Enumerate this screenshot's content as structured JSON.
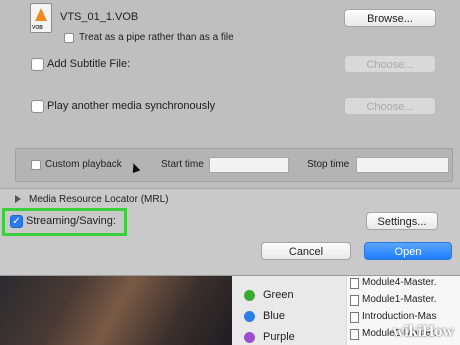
{
  "file": {
    "name": "VTS_01_1.VOB",
    "icon_caption": "VOB",
    "browse_label": "Browse...",
    "pipe_label": "Treat as a pipe rather than as a file"
  },
  "subtitle": {
    "label": "Add Subtitle File:",
    "choose_label": "Choose..."
  },
  "sync_media": {
    "label": "Play another media synchronously",
    "choose_label": "Choose..."
  },
  "custom_playback": {
    "label": "Custom playback",
    "start_label": "Start time",
    "start_value": "",
    "stop_label": "Stop time",
    "stop_value": ""
  },
  "mrl": {
    "label": "Media Resource Locator (MRL)"
  },
  "streaming": {
    "label": "Streaming/Saving:",
    "checked": true,
    "settings_label": "Settings..."
  },
  "actions": {
    "cancel_label": "Cancel",
    "open_label": "Open"
  },
  "finder": {
    "tags": [
      {
        "name": "Green",
        "color": "#3aaa35"
      },
      {
        "name": "Blue",
        "color": "#2c7fe8"
      },
      {
        "name": "Purple",
        "color": "#9b4fcf"
      }
    ],
    "files": [
      "Module4-Master.",
      "Module1-Master.",
      "Introduction-Mas",
      "Module2-Master."
    ]
  },
  "watermark": "wikiHow",
  "colors": {
    "highlight": "#3ccf3c",
    "accent": "#1f7dff"
  }
}
